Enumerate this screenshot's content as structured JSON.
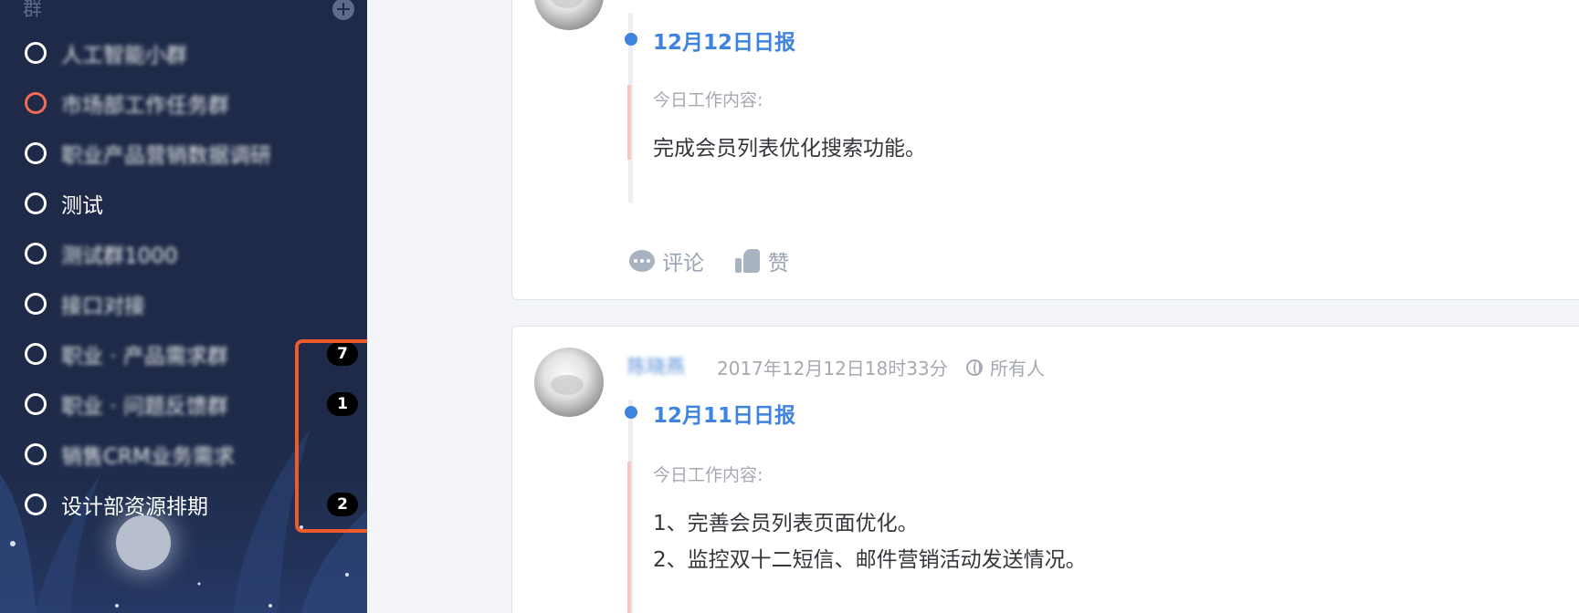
{
  "sidebar": {
    "section_title": "群",
    "groups": [
      {
        "label": "人工智能小群",
        "badge": ""
      },
      {
        "label": "市场部工作任务群",
        "badge": ""
      },
      {
        "label": "职业产品营销数据调研",
        "badge": ""
      },
      {
        "label": "测试",
        "badge": ""
      },
      {
        "label": "测试群1000",
        "badge": ""
      },
      {
        "label": "接口对接",
        "badge": ""
      },
      {
        "label": "职业 · 产品需求群",
        "badge": "7"
      },
      {
        "label": "职业 · 问题反馈群",
        "badge": "1"
      },
      {
        "label": "销售CRM业务需求",
        "badge": ""
      },
      {
        "label": "设计部资源排期",
        "badge": "2"
      }
    ]
  },
  "feed": {
    "posts": [
      {
        "title": "12月12日日报",
        "section_label": "今日工作内容:",
        "lines": [
          "完成会员列表优化搜索功能。"
        ],
        "comment_label": "评论",
        "like_label": "赞"
      },
      {
        "author": "陈晓燕",
        "time": "2017年12月12日18时33分",
        "audience": "所有人",
        "title": "12月11日日报",
        "section_label": "今日工作内容:",
        "lines": [
          "1、完善会员列表页面优化。",
          "2、监控双十二短信、邮件营销活动发送情况。"
        ]
      }
    ]
  },
  "colors": {
    "sidebar_bg": "#1e2a47",
    "accent_blue": "#3f83e0",
    "active_ring": "#f26b55",
    "highlight_box": "#ef5a2b"
  }
}
